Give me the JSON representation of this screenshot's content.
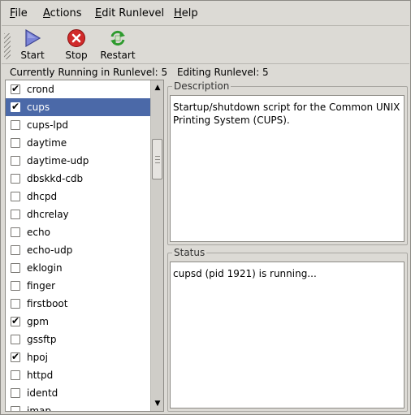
{
  "menubar": {
    "items": [
      {
        "label": "File",
        "mnemonic": "F",
        "rest": "ile"
      },
      {
        "label": "Actions",
        "mnemonic": "A",
        "rest": "ctions"
      },
      {
        "label": "Edit Runlevel",
        "mnemonic": "E",
        "rest": "dit Runlevel"
      },
      {
        "label": "Help",
        "mnemonic": "H",
        "rest": "elp"
      }
    ]
  },
  "toolbar": {
    "start_label": "Start",
    "stop_label": "Stop",
    "restart_label": "Restart",
    "icons": {
      "start": "play-triangle-icon",
      "stop": "stop-icon",
      "restart": "restart-arrows-icon"
    },
    "colors": {
      "start": "#7b84d8",
      "stop": "#d12a2a",
      "restart": "#2e9b2e"
    }
  },
  "runlevel": {
    "current": "Currently Running in Runlevel: 5",
    "editing": "Editing Runlevel: 5"
  },
  "services": [
    {
      "name": "crond",
      "checked": true,
      "selected": false
    },
    {
      "name": "cups",
      "checked": true,
      "selected": true
    },
    {
      "name": "cups-lpd",
      "checked": false,
      "selected": false
    },
    {
      "name": "daytime",
      "checked": false,
      "selected": false
    },
    {
      "name": "daytime-udp",
      "checked": false,
      "selected": false
    },
    {
      "name": "dbskkd-cdb",
      "checked": false,
      "selected": false
    },
    {
      "name": "dhcpd",
      "checked": false,
      "selected": false
    },
    {
      "name": "dhcrelay",
      "checked": false,
      "selected": false
    },
    {
      "name": "echo",
      "checked": false,
      "selected": false
    },
    {
      "name": "echo-udp",
      "checked": false,
      "selected": false
    },
    {
      "name": "eklogin",
      "checked": false,
      "selected": false
    },
    {
      "name": "finger",
      "checked": false,
      "selected": false
    },
    {
      "name": "firstboot",
      "checked": false,
      "selected": false
    },
    {
      "name": "gpm",
      "checked": true,
      "selected": false
    },
    {
      "name": "gssftp",
      "checked": false,
      "selected": false
    },
    {
      "name": "hpoj",
      "checked": true,
      "selected": false
    },
    {
      "name": "httpd",
      "checked": false,
      "selected": false
    },
    {
      "name": "identd",
      "checked": false,
      "selected": false
    },
    {
      "name": "imap",
      "checked": false,
      "selected": false
    }
  ],
  "selection_color": "#4b69a8",
  "description": {
    "title": "Description",
    "text": "Startup/shutdown script for the Common UNIX Printing System (CUPS)."
  },
  "status": {
    "title": "Status",
    "text": "cupsd (pid 1921) is running..."
  }
}
